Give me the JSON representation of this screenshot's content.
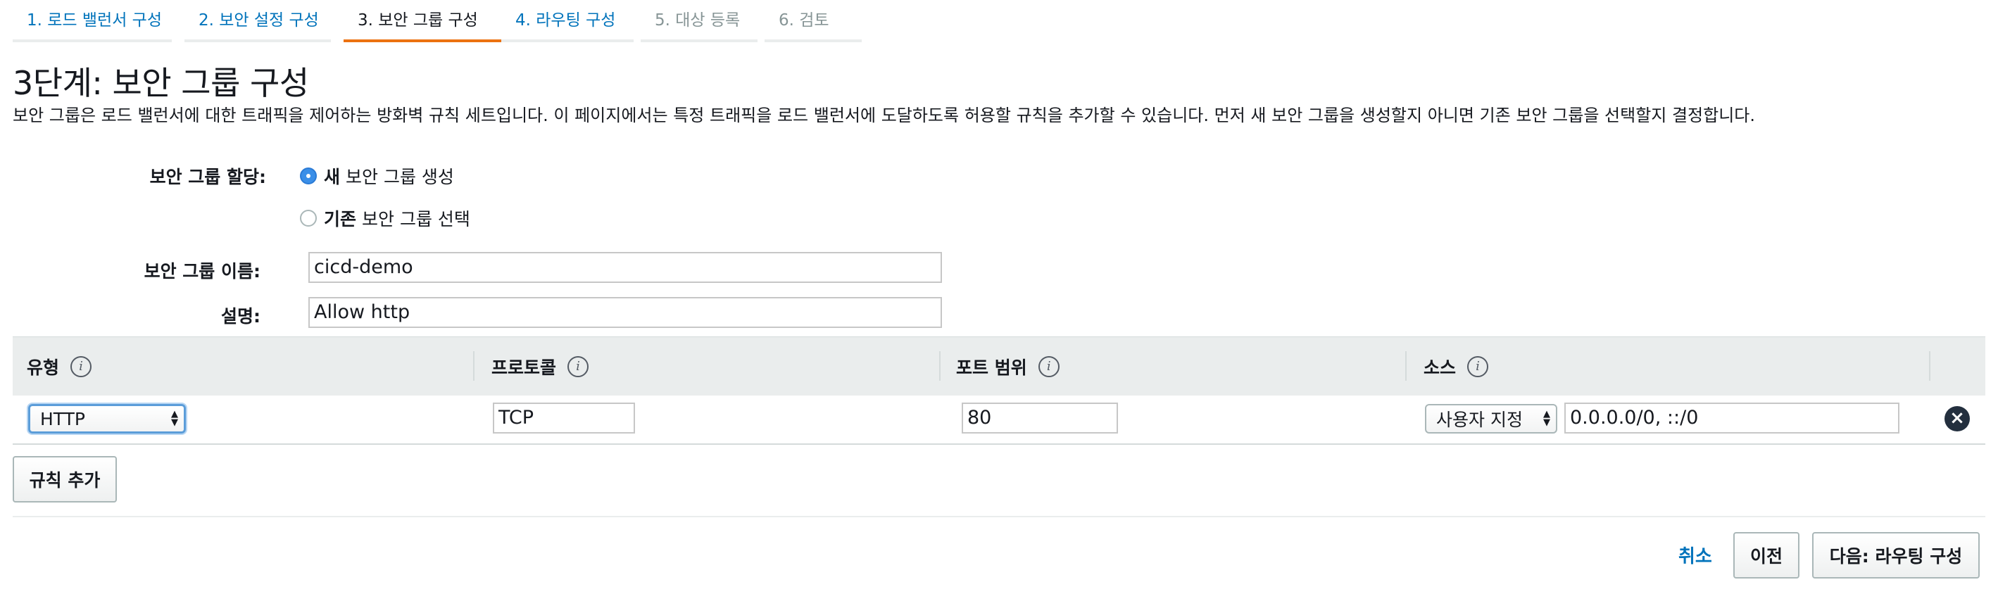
{
  "tabs": [
    {
      "label": "1. 로드 밸런서 구성",
      "state": "link"
    },
    {
      "label": "2. 보안 설정 구성",
      "state": "link"
    },
    {
      "label": "3. 보안 그룹 구성",
      "state": "active"
    },
    {
      "label": "4. 라우팅 구성",
      "state": "link"
    },
    {
      "label": "5. 대상 등록",
      "state": "disabled"
    },
    {
      "label": "6. 검토",
      "state": "disabled"
    }
  ],
  "page": {
    "title": "3단계: 보안 그룹 구성",
    "description": "보안 그룹은 로드 밸런서에 대한 트래픽을 제어하는 방화벽 규칙 세트입니다. 이 페이지에서는 특정 트래픽을 로드 밸런서에 도달하도록 허용할 규칙을 추가할 수 있습니다. 먼저 새 보안 그룹을 생성할지 아니면 기존 보안 그룹을 선택할지 결정합니다."
  },
  "form": {
    "assign_label": "보안 그룹 할당:",
    "option_new_bold": "새",
    "option_new_rest": "보안 그룹 생성",
    "option_existing_bold": "기존",
    "option_existing_rest": "보안 그룹 선택",
    "selected_option": "new",
    "name_label": "보안 그룹 이름:",
    "name_value": "cicd-demo",
    "desc_label": "설명:",
    "desc_value": "Allow http"
  },
  "rules_table": {
    "columns": [
      {
        "label": "유형"
      },
      {
        "label": "프로토콜"
      },
      {
        "label": "포트 범위"
      },
      {
        "label": "소스"
      }
    ],
    "info_glyph": "i",
    "rows": [
      {
        "type": "HTTP",
        "protocol": "TCP",
        "port_range": "80",
        "source_mode": "사용자 지정",
        "source_value": "0.0.0.0/0, ::/0"
      }
    ]
  },
  "icons": {
    "remove": "close-circle-icon",
    "info": "info-icon",
    "select_arrows": "updown-arrows-icon"
  },
  "buttons": {
    "add_rule": "규칙 추가",
    "cancel": "취소",
    "previous": "이전",
    "next": "다음: 라우팅 구성"
  },
  "colors": {
    "link": "#0073bb",
    "active_tab": "#ec7211",
    "radio_checked": "#3b8fe8"
  }
}
